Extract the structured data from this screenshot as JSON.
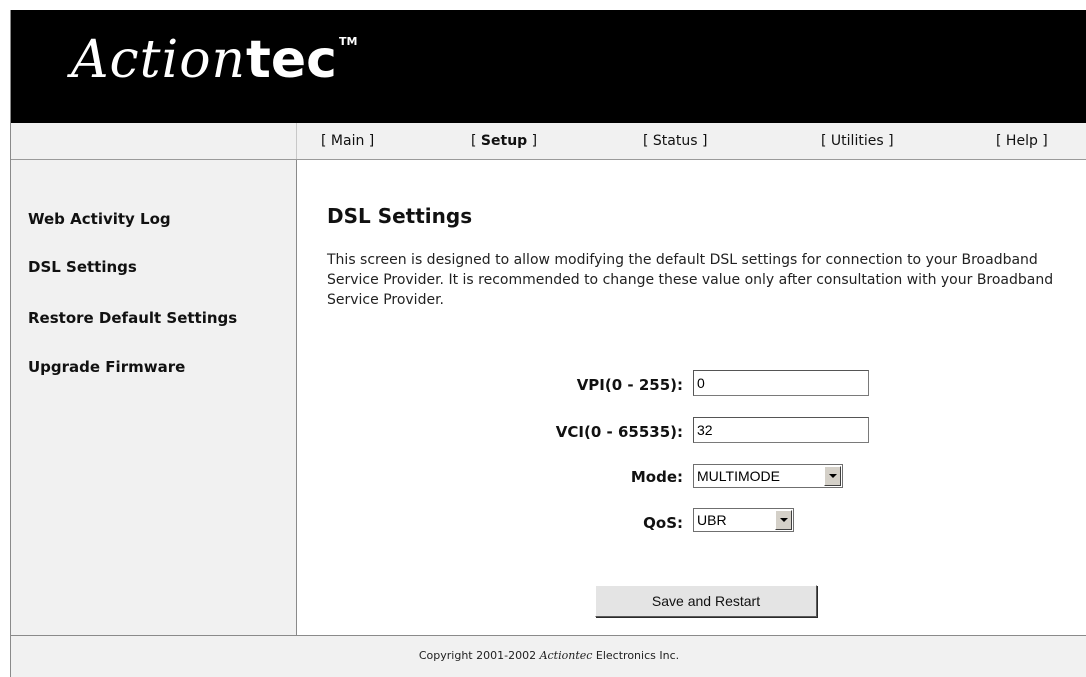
{
  "header": {
    "logo_script": "Action",
    "logo_bold": "tec",
    "logo_tm": "TM",
    "background": "#000000"
  },
  "nav": {
    "items": [
      {
        "label": "Main",
        "active": false
      },
      {
        "label": "Setup",
        "active": true
      },
      {
        "label": "Status",
        "active": false
      },
      {
        "label": "Utilities",
        "active": false
      },
      {
        "label": "Help",
        "active": false
      }
    ]
  },
  "sidebar": {
    "items": [
      {
        "label": "Web Activity Log"
      },
      {
        "label": "DSL Settings"
      },
      {
        "label": "Restore Default Settings"
      },
      {
        "label": "Upgrade Firmware"
      }
    ]
  },
  "main": {
    "title": "DSL Settings",
    "description": "This screen is designed to allow modifying the default DSL settings for connection to your Broadband Service Provider. It is recommended to change these value only after consultation with your Broadband Service Provider."
  },
  "form": {
    "vpi_label": "VPI(0 - 255):",
    "vpi_value": "0",
    "vci_label": "VCI(0 - 65535):",
    "vci_value": "32",
    "mode_label": "Mode:",
    "mode_value": "MULTIMODE",
    "qos_label": "QoS:",
    "qos_value": "UBR",
    "save_label": "Save and Restart"
  },
  "footer": {
    "prefix": "Copyright 2001-2002 ",
    "brand": "Actiontec",
    "suffix": " Electronics Inc."
  }
}
